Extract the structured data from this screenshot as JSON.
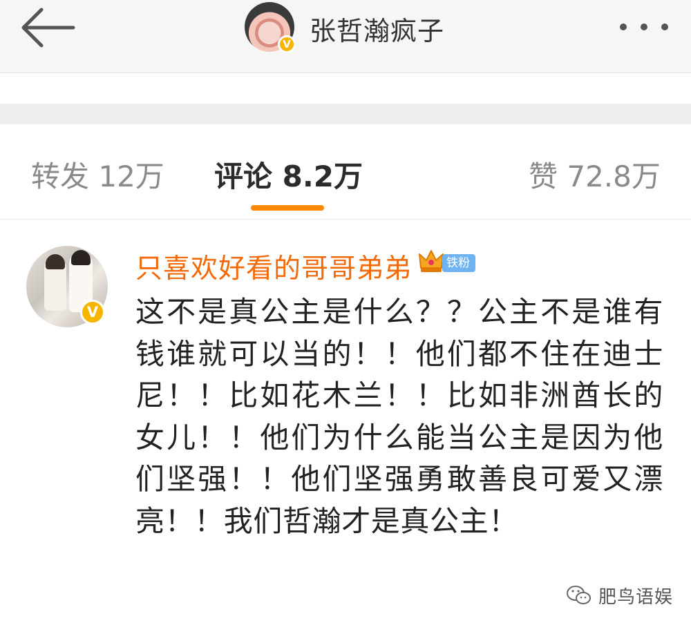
{
  "header": {
    "title": "张哲瀚疯子",
    "back_icon": "arrow-left-icon",
    "more_icon": "more-dots-icon",
    "avatar_badge": "V"
  },
  "tabs": [
    {
      "label": "转发 12万",
      "active": false
    },
    {
      "label": "评论 8.2万",
      "active": true
    },
    {
      "label": "赞 72.8万",
      "active": false
    }
  ],
  "colors": {
    "accent": "#ff8a00",
    "username": "#f26a0a",
    "verified": "#f7b500",
    "fan_badge": "#6fb3f2"
  },
  "comment": {
    "username": "只喜欢好看的哥哥弟弟",
    "badge_icon": "crown-icon",
    "fan_badge": "铁粉",
    "avatar_badge": "V",
    "text": "这不是真公主是什么？？公主不是谁有钱谁就可以当的！！他们都不住在迪士尼！！比如花木兰！！比如非洲酋长的女儿！！他们为什么能当公主是因为他们坚强！！他们坚强勇敢善良可爱又漂亮！！我们哲瀚才是真公主！"
  },
  "watermark": {
    "icon": "wechat-icon",
    "text": "肥鸟语娱"
  }
}
